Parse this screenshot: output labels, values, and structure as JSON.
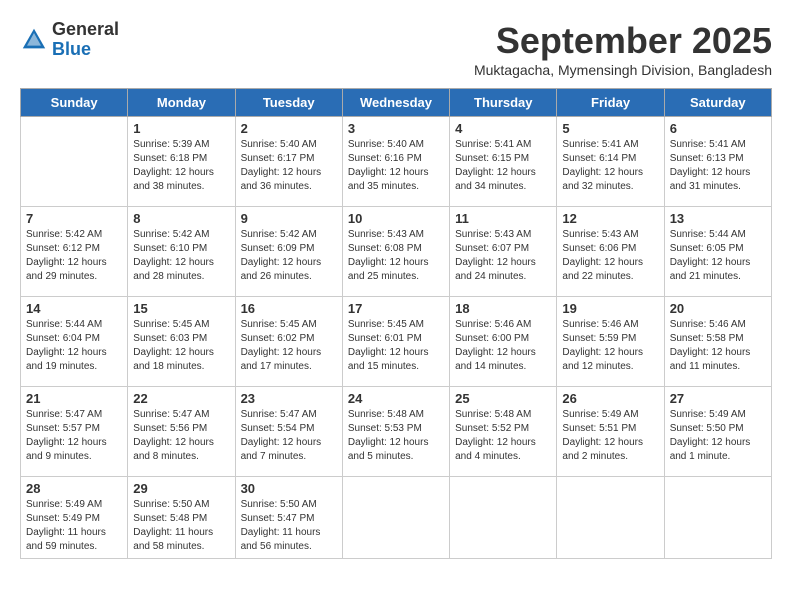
{
  "header": {
    "logo_general": "General",
    "logo_blue": "Blue",
    "month_title": "September 2025",
    "location": "Muktagacha, Mymensingh Division, Bangladesh"
  },
  "days_of_week": [
    "Sunday",
    "Monday",
    "Tuesday",
    "Wednesday",
    "Thursday",
    "Friday",
    "Saturday"
  ],
  "weeks": [
    [
      {
        "day": "",
        "lines": []
      },
      {
        "day": "1",
        "lines": [
          "Sunrise: 5:39 AM",
          "Sunset: 6:18 PM",
          "Daylight: 12 hours",
          "and 38 minutes."
        ]
      },
      {
        "day": "2",
        "lines": [
          "Sunrise: 5:40 AM",
          "Sunset: 6:17 PM",
          "Daylight: 12 hours",
          "and 36 minutes."
        ]
      },
      {
        "day": "3",
        "lines": [
          "Sunrise: 5:40 AM",
          "Sunset: 6:16 PM",
          "Daylight: 12 hours",
          "and 35 minutes."
        ]
      },
      {
        "day": "4",
        "lines": [
          "Sunrise: 5:41 AM",
          "Sunset: 6:15 PM",
          "Daylight: 12 hours",
          "and 34 minutes."
        ]
      },
      {
        "day": "5",
        "lines": [
          "Sunrise: 5:41 AM",
          "Sunset: 6:14 PM",
          "Daylight: 12 hours",
          "and 32 minutes."
        ]
      },
      {
        "day": "6",
        "lines": [
          "Sunrise: 5:41 AM",
          "Sunset: 6:13 PM",
          "Daylight: 12 hours",
          "and 31 minutes."
        ]
      }
    ],
    [
      {
        "day": "7",
        "lines": [
          "Sunrise: 5:42 AM",
          "Sunset: 6:12 PM",
          "Daylight: 12 hours",
          "and 29 minutes."
        ]
      },
      {
        "day": "8",
        "lines": [
          "Sunrise: 5:42 AM",
          "Sunset: 6:10 PM",
          "Daylight: 12 hours",
          "and 28 minutes."
        ]
      },
      {
        "day": "9",
        "lines": [
          "Sunrise: 5:42 AM",
          "Sunset: 6:09 PM",
          "Daylight: 12 hours",
          "and 26 minutes."
        ]
      },
      {
        "day": "10",
        "lines": [
          "Sunrise: 5:43 AM",
          "Sunset: 6:08 PM",
          "Daylight: 12 hours",
          "and 25 minutes."
        ]
      },
      {
        "day": "11",
        "lines": [
          "Sunrise: 5:43 AM",
          "Sunset: 6:07 PM",
          "Daylight: 12 hours",
          "and 24 minutes."
        ]
      },
      {
        "day": "12",
        "lines": [
          "Sunrise: 5:43 AM",
          "Sunset: 6:06 PM",
          "Daylight: 12 hours",
          "and 22 minutes."
        ]
      },
      {
        "day": "13",
        "lines": [
          "Sunrise: 5:44 AM",
          "Sunset: 6:05 PM",
          "Daylight: 12 hours",
          "and 21 minutes."
        ]
      }
    ],
    [
      {
        "day": "14",
        "lines": [
          "Sunrise: 5:44 AM",
          "Sunset: 6:04 PM",
          "Daylight: 12 hours",
          "and 19 minutes."
        ]
      },
      {
        "day": "15",
        "lines": [
          "Sunrise: 5:45 AM",
          "Sunset: 6:03 PM",
          "Daylight: 12 hours",
          "and 18 minutes."
        ]
      },
      {
        "day": "16",
        "lines": [
          "Sunrise: 5:45 AM",
          "Sunset: 6:02 PM",
          "Daylight: 12 hours",
          "and 17 minutes."
        ]
      },
      {
        "day": "17",
        "lines": [
          "Sunrise: 5:45 AM",
          "Sunset: 6:01 PM",
          "Daylight: 12 hours",
          "and 15 minutes."
        ]
      },
      {
        "day": "18",
        "lines": [
          "Sunrise: 5:46 AM",
          "Sunset: 6:00 PM",
          "Daylight: 12 hours",
          "and 14 minutes."
        ]
      },
      {
        "day": "19",
        "lines": [
          "Sunrise: 5:46 AM",
          "Sunset: 5:59 PM",
          "Daylight: 12 hours",
          "and 12 minutes."
        ]
      },
      {
        "day": "20",
        "lines": [
          "Sunrise: 5:46 AM",
          "Sunset: 5:58 PM",
          "Daylight: 12 hours",
          "and 11 minutes."
        ]
      }
    ],
    [
      {
        "day": "21",
        "lines": [
          "Sunrise: 5:47 AM",
          "Sunset: 5:57 PM",
          "Daylight: 12 hours",
          "and 9 minutes."
        ]
      },
      {
        "day": "22",
        "lines": [
          "Sunrise: 5:47 AM",
          "Sunset: 5:56 PM",
          "Daylight: 12 hours",
          "and 8 minutes."
        ]
      },
      {
        "day": "23",
        "lines": [
          "Sunrise: 5:47 AM",
          "Sunset: 5:54 PM",
          "Daylight: 12 hours",
          "and 7 minutes."
        ]
      },
      {
        "day": "24",
        "lines": [
          "Sunrise: 5:48 AM",
          "Sunset: 5:53 PM",
          "Daylight: 12 hours",
          "and 5 minutes."
        ]
      },
      {
        "day": "25",
        "lines": [
          "Sunrise: 5:48 AM",
          "Sunset: 5:52 PM",
          "Daylight: 12 hours",
          "and 4 minutes."
        ]
      },
      {
        "day": "26",
        "lines": [
          "Sunrise: 5:49 AM",
          "Sunset: 5:51 PM",
          "Daylight: 12 hours",
          "and 2 minutes."
        ]
      },
      {
        "day": "27",
        "lines": [
          "Sunrise: 5:49 AM",
          "Sunset: 5:50 PM",
          "Daylight: 12 hours",
          "and 1 minute."
        ]
      }
    ],
    [
      {
        "day": "28",
        "lines": [
          "Sunrise: 5:49 AM",
          "Sunset: 5:49 PM",
          "Daylight: 11 hours",
          "and 59 minutes."
        ]
      },
      {
        "day": "29",
        "lines": [
          "Sunrise: 5:50 AM",
          "Sunset: 5:48 PM",
          "Daylight: 11 hours",
          "and 58 minutes."
        ]
      },
      {
        "day": "30",
        "lines": [
          "Sunrise: 5:50 AM",
          "Sunset: 5:47 PM",
          "Daylight: 11 hours",
          "and 56 minutes."
        ]
      },
      {
        "day": "",
        "lines": []
      },
      {
        "day": "",
        "lines": []
      },
      {
        "day": "",
        "lines": []
      },
      {
        "day": "",
        "lines": []
      }
    ]
  ]
}
